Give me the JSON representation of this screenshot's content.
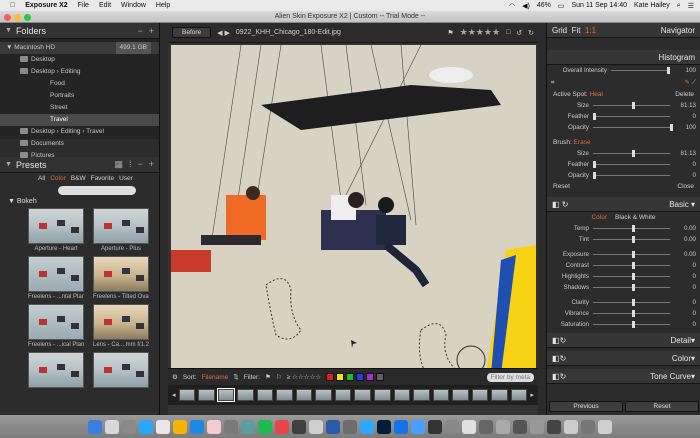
{
  "menubar": {
    "app": "Exposure X2",
    "items": [
      "File",
      "Edit",
      "Window",
      "Help"
    ],
    "battery": "46%",
    "datetime": "Sun 11 Sep  14:40",
    "user": "Kate Hailey"
  },
  "window": {
    "title": "Alien Skin Exposure X2 | Custom -- Trial Mode --"
  },
  "folders": {
    "title": "Folders",
    "drive": "Macintosh HD",
    "size": "499.1 GB",
    "tree": [
      "Desktop",
      "Desktop › Editing",
      "Food",
      "Portraits",
      "Street",
      "Travel",
      "Desktop › Editing › Travel",
      "Documents",
      "Pictures"
    ],
    "selected": "Travel"
  },
  "presets": {
    "title": "Presets",
    "tabs": [
      "All",
      "Color",
      "B&W",
      "Favorite",
      "User"
    ],
    "active_tab": "Color",
    "group": "Bokeh",
    "items": [
      "Aperture - Heart",
      "Aperture - Plus",
      "Freelens - ...ntal Plane",
      "Freelens - Tilted Oval",
      "Freelens - ...ical Plane",
      "Lens - Ca....mm f/1.2L"
    ]
  },
  "toolbar": {
    "before_label": "Before",
    "filename": "0922_KHH_Chicago_180-Edit.jpg",
    "stars": "★★★★★"
  },
  "filter": {
    "sort_label": "Sort:",
    "sort_value": "Filename",
    "filter_label": "Filter:",
    "rating": "≥ ☆☆☆☆☆",
    "search_placeholder": "Filter by meta"
  },
  "colors": {
    "swatches": [
      "#e02020",
      "#f0e020",
      "#20c020",
      "#2040e0",
      "#a030d0",
      "#606060"
    ],
    "accent": "#e66b3a"
  },
  "navigator": {
    "title": "Navigator",
    "zoom": [
      "Grid",
      "Fit",
      "1:1"
    ],
    "active_zoom": "1:1"
  },
  "histogram": {
    "title": "Histogram",
    "overall_label": "Overall Intensity",
    "overall_value": "100"
  },
  "spot": {
    "active_label": "Active Spot:",
    "mode": "Heal",
    "delete_label": "Delete",
    "rows": [
      {
        "label": "Size",
        "value": "81.13"
      },
      {
        "label": "Feather",
        "value": "0"
      },
      {
        "label": "Opacity",
        "value": "100"
      }
    ]
  },
  "brush": {
    "label": "Brush:",
    "mode": "Erase",
    "rows": [
      {
        "label": "Size",
        "value": "81.13"
      },
      {
        "label": "Feather",
        "value": "0"
      },
      {
        "label": "Opacity",
        "value": "0"
      }
    ],
    "reset_label": "Reset",
    "close_label": "Close"
  },
  "basic": {
    "title": "Basic",
    "tabs": [
      "Color",
      "Black & White"
    ],
    "active_tab": "Color",
    "rows": [
      {
        "label": "Temp",
        "value": "0.00"
      },
      {
        "label": "Tint",
        "value": "0.00"
      },
      {
        "label": "Exposure",
        "value": "0.00"
      },
      {
        "label": "Contrast",
        "value": "0"
      },
      {
        "label": "Highlights",
        "value": "0"
      },
      {
        "label": "Shadows",
        "value": "0"
      },
      {
        "label": "Clarity",
        "value": "0"
      },
      {
        "label": "Vibrance",
        "value": "0"
      },
      {
        "label": "Saturation",
        "value": "0"
      }
    ]
  },
  "sections": [
    "Detail",
    "Color",
    "Tone Curve"
  ],
  "footer": {
    "previous_label": "Previous",
    "reset_label": "Reset"
  }
}
